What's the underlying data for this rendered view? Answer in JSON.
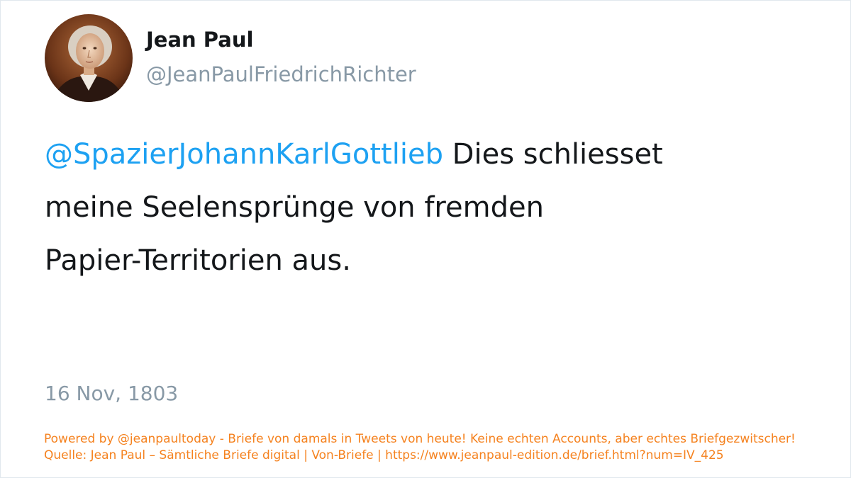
{
  "user": {
    "display_name": "Jean Paul",
    "handle": "@JeanPaulFriedrichRichter",
    "avatar_icon": "portrait-avatar"
  },
  "tweet": {
    "mention": "@SpazierJohannKarlGottlieb",
    "text_line1": " Dies schliesset",
    "text_line2": "meine Seelensprünge von fremden",
    "text_line3": "Papier-Territorien aus.",
    "date": "16 Nov, 1803"
  },
  "footer": {
    "line1": "Powered by @jeanpaultoday - Briefe von damals in Tweets von heute! Keine echten Accounts, aber echtes Briefgezwitscher!",
    "line2": "Quelle: Jean Paul – Sämtliche Briefe digital | Von-Briefe | https://www.jeanpaul-edition.de/brief.html?num=IV_425"
  },
  "colors": {
    "mention": "#1da1f2",
    "text": "#14171a",
    "muted": "#8899a6",
    "footer": "#f5821f"
  }
}
